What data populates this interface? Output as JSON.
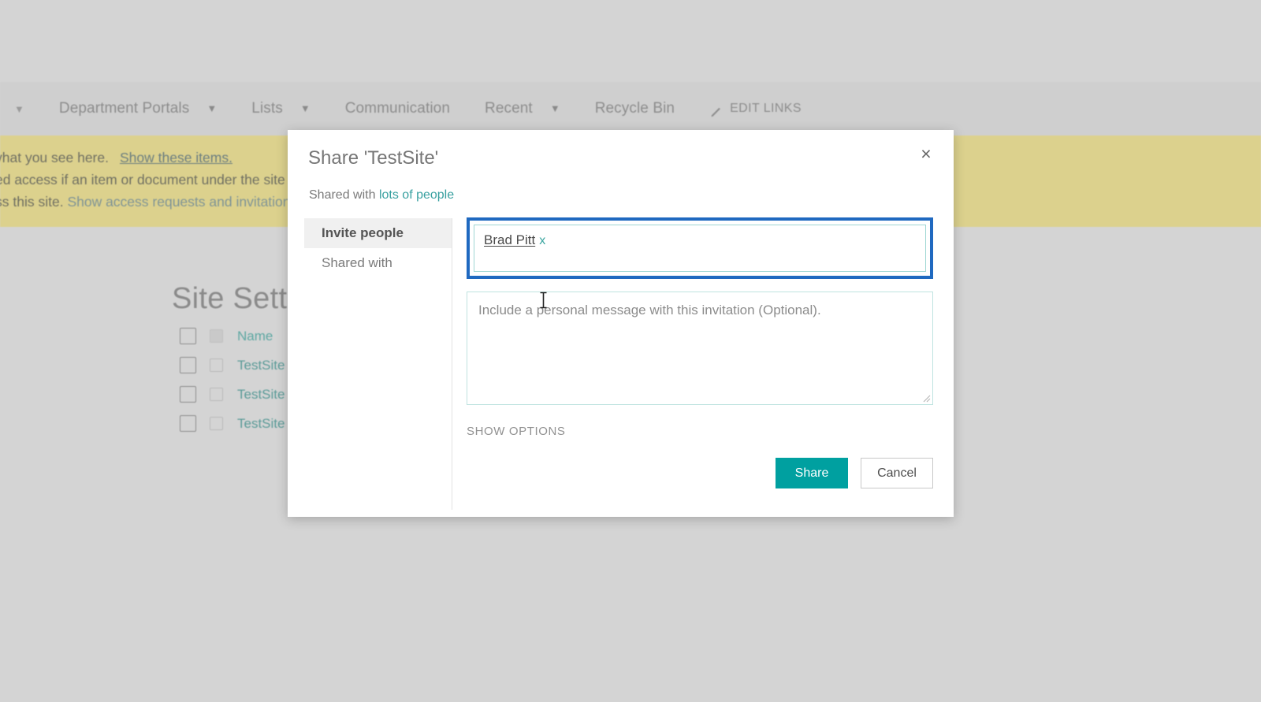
{
  "background": {
    "top_nav": {
      "items": [
        {
          "label": "Department Portals",
          "has_caret": true
        },
        {
          "label": "Lists",
          "has_caret": true
        },
        {
          "label": "Communication",
          "has_caret": false
        },
        {
          "label": "Recent",
          "has_caret": true
        },
        {
          "label": "Recycle Bin",
          "has_caret": false
        }
      ],
      "edit_links_label": "EDIT LINKS"
    },
    "notice_banner": {
      "line1_text": "vhat you see here.",
      "line1_link": "Show these items.",
      "line2": "ed access if an item or document under the site",
      "line3_prefix": "ss this site.",
      "line3_link": "Show access requests and invitation"
    },
    "page_heading": "Site Sett",
    "list_rows": [
      {
        "label": "Name",
        "header": true
      },
      {
        "label": "TestSite",
        "header": false
      },
      {
        "label": "TestSite",
        "header": false
      },
      {
        "label": "TestSite",
        "header": false
      }
    ]
  },
  "dialog": {
    "title": "Share 'TestSite'",
    "close_label": "×",
    "shared_with_prefix": "Shared with",
    "shared_with_link": "lots of people",
    "tabs": [
      {
        "label": "Invite people",
        "active": true
      },
      {
        "label": "Shared with",
        "active": false
      }
    ],
    "recipients": {
      "person_name": "Brad Pitt",
      "remove_label": "x"
    },
    "message": {
      "placeholder": "Include a personal message with this invitation (Optional)."
    },
    "show_options_label": "SHOW OPTIONS",
    "buttons": {
      "share_label": "Share",
      "cancel_label": "Cancel"
    }
  },
  "colors": {
    "accent_teal": "#00a0a0",
    "focus_blue": "#1f69c0",
    "banner_yellow": "#dcd18d",
    "page_gray": "#d4d4d4",
    "link_teal": "#38a0a0"
  }
}
